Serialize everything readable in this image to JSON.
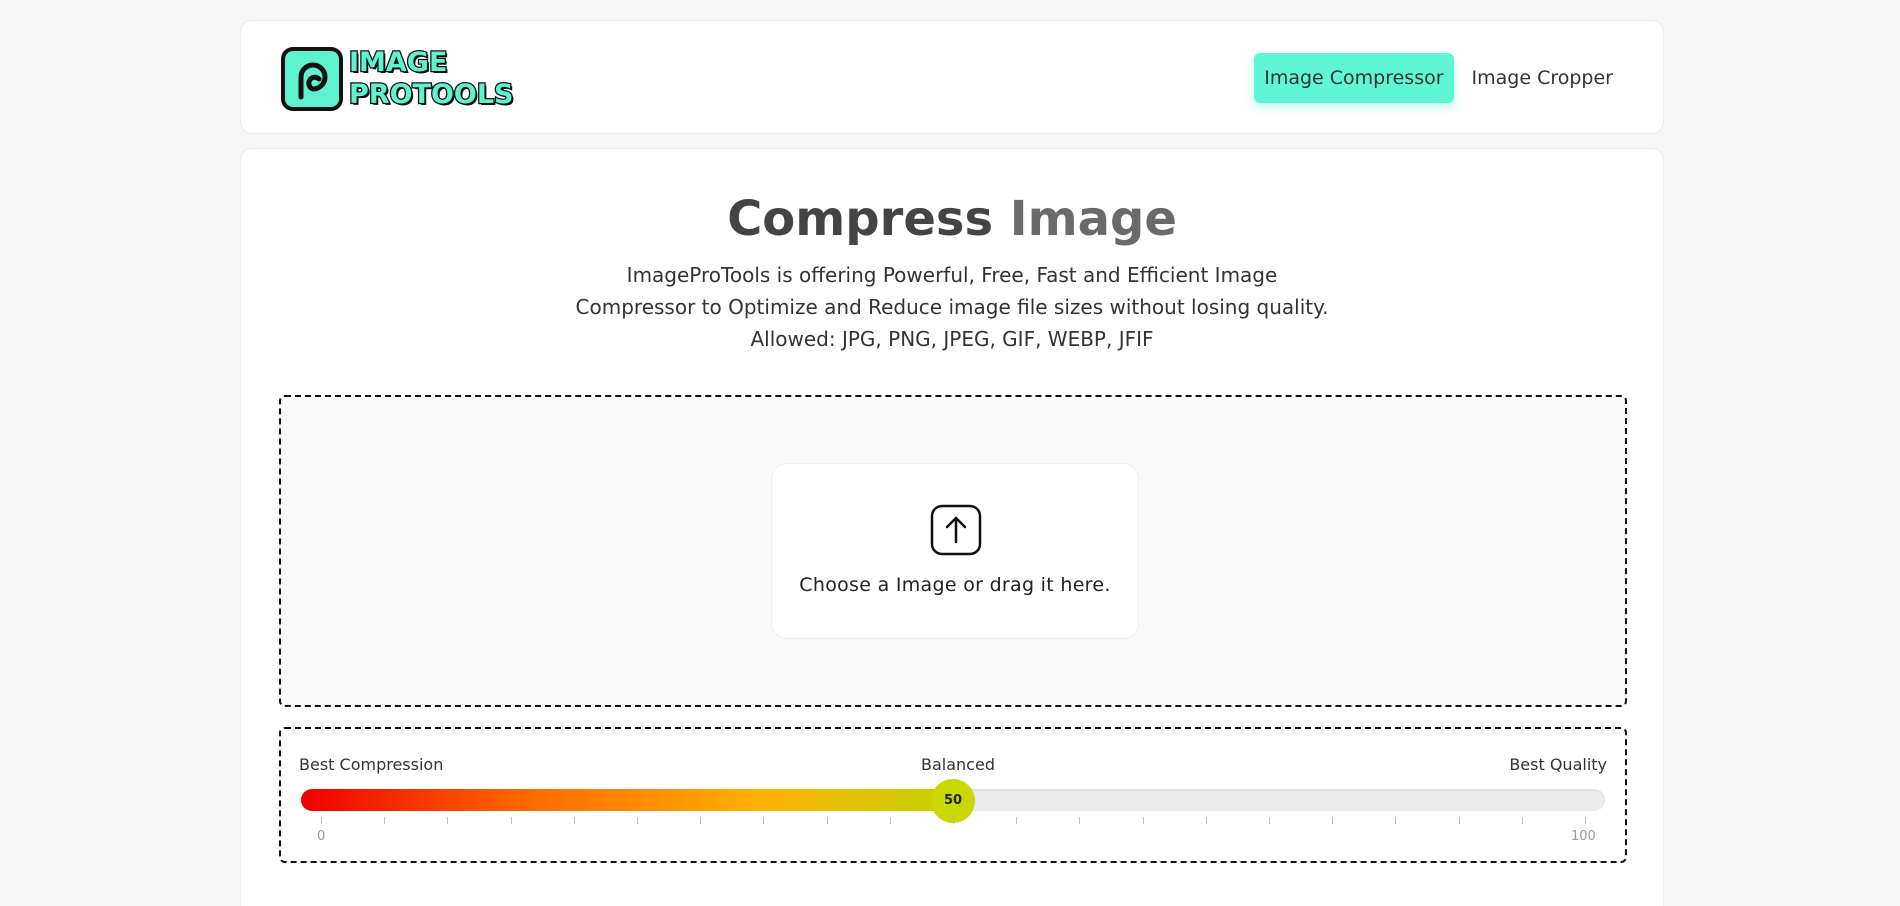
{
  "header": {
    "logo_line1": "IMAGE",
    "logo_line2": "PROTOOLS",
    "nav": [
      {
        "label": "Image Compressor",
        "active": true
      },
      {
        "label": "Image Cropper",
        "active": false
      }
    ]
  },
  "main": {
    "title_part1": "Compress",
    "title_part2": "Image",
    "description_lines": [
      "ImageProTools is offering Powerful, Free, Fast and Efficient Image",
      "Compressor to Optimize and Reduce image file sizes without losing quality.",
      "Allowed: JPG, PNG, JPEG, GIF, WEBP, JFIF"
    ],
    "upload_text": "Choose a Image or drag it here.",
    "upload_icon": "upload-arrow-icon"
  },
  "slider": {
    "label_left": "Best Compression",
    "label_mid": "Balanced",
    "label_right": "Best Quality",
    "value": 50,
    "value_label": "50",
    "min": 0,
    "max": 100,
    "min_label": "0",
    "max_label": "100",
    "tick_count": 21
  },
  "colors": {
    "accent": "#5ff7d3",
    "thumb": "#cbd800"
  }
}
